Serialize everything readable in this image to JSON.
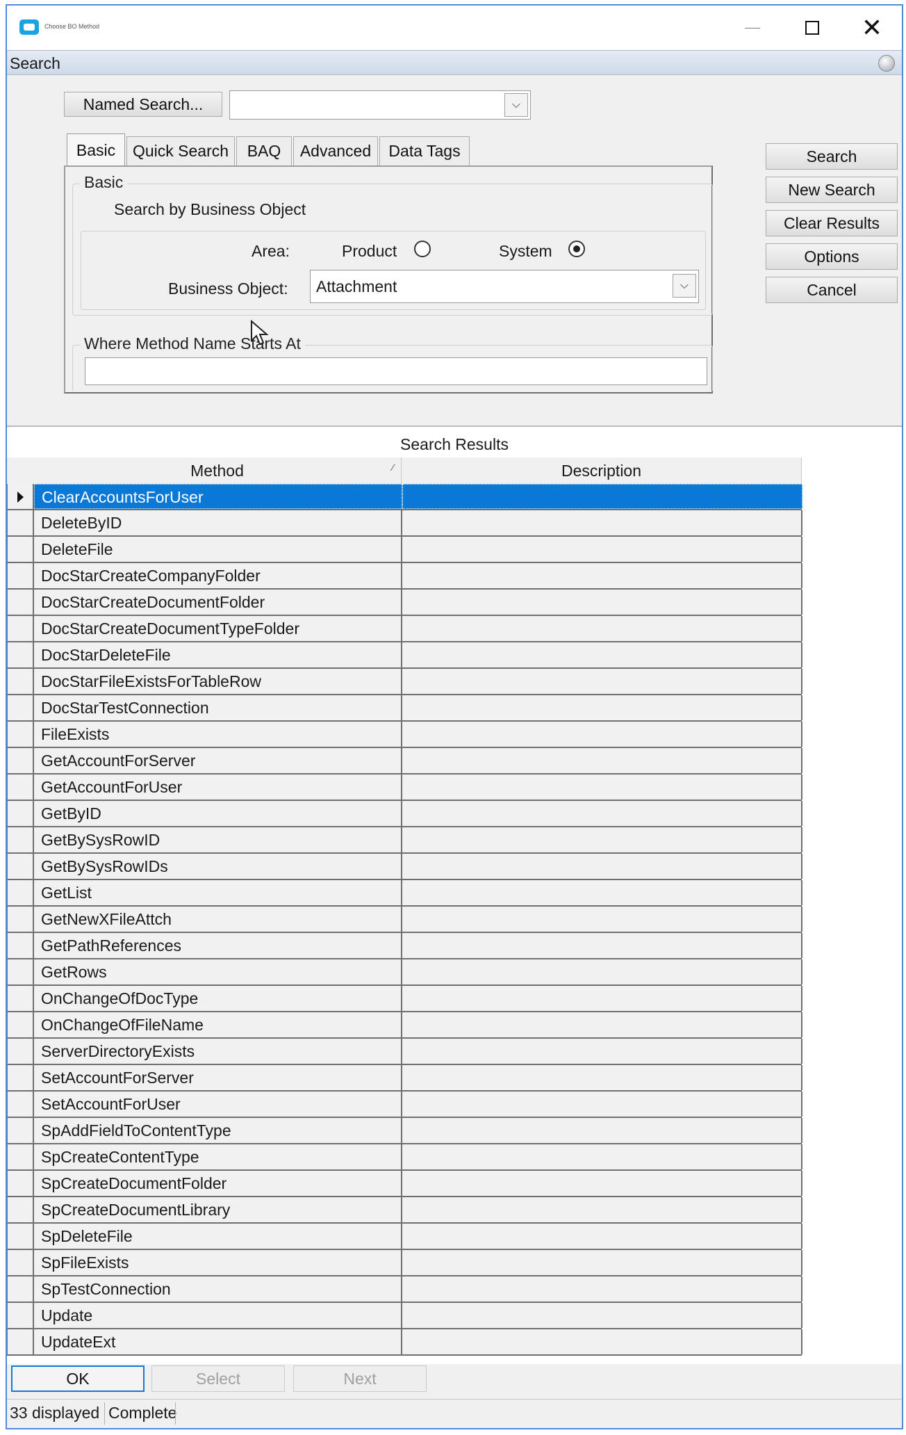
{
  "window": {
    "title": "Choose BO Method",
    "minimize_label": "",
    "close_glyph": "✕"
  },
  "search_panel": {
    "header": "Search",
    "named_search_button": "Named Search...",
    "named_search_value": "",
    "tabs": [
      {
        "label": "Basic",
        "active": true
      },
      {
        "label": "Quick Search",
        "active": false
      },
      {
        "label": "BAQ",
        "active": false
      },
      {
        "label": "Advanced",
        "active": false
      },
      {
        "label": "Data Tags",
        "active": false
      }
    ],
    "basic": {
      "group_label": "Basic",
      "subtitle": "Search by Business Object",
      "area_label": "Area:",
      "area_options": [
        {
          "label": "Product",
          "checked": false
        },
        {
          "label": "System",
          "checked": true
        }
      ],
      "business_object_label": "Business Object:",
      "business_object_value": "Attachment",
      "where_group_label": "Where Method Name Starts At",
      "where_value": ""
    },
    "actions": [
      "Search",
      "New Search",
      "Clear Results",
      "Options",
      "Cancel"
    ]
  },
  "results": {
    "title": "Search Results",
    "columns": [
      "Method",
      "Description"
    ],
    "selected_index": 0,
    "rows": [
      "ClearAccountsForUser",
      "DeleteByID",
      "DeleteFile",
      "DocStarCreateCompanyFolder",
      "DocStarCreateDocumentFolder",
      "DocStarCreateDocumentTypeFolder",
      "DocStarDeleteFile",
      "DocStarFileExistsForTableRow",
      "DocStarTestConnection",
      "FileExists",
      "GetAccountForServer",
      "GetAccountForUser",
      "GetByID",
      "GetBySysRowID",
      "GetBySysRowIDs",
      "GetList",
      "GetNewXFileAttch",
      "GetPathReferences",
      "GetRows",
      "OnChangeOfDocType",
      "OnChangeOfFileName",
      "ServerDirectoryExists",
      "SetAccountForServer",
      "SetAccountForUser",
      "SpAddFieldToContentType",
      "SpCreateContentType",
      "SpCreateDocumentFolder",
      "SpCreateDocumentLibrary",
      "SpDeleteFile",
      "SpFileExists",
      "SpTestConnection",
      "Update",
      "UpdateExt"
    ]
  },
  "footer": {
    "ok": "OK",
    "select": "Select",
    "next": "Next",
    "status_count": "33 displayed",
    "status_state": "Complete"
  },
  "colors": {
    "selection": "#0a78d7",
    "window_border": "#4f8bd6"
  }
}
